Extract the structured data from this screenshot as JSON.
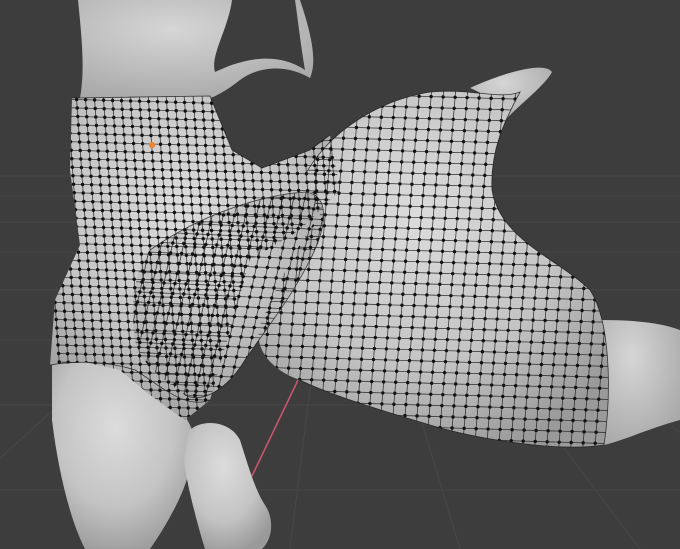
{
  "viewport": {
    "mode": "edit-mode",
    "background_color": "#3d3d3d",
    "grid_color": "#474747",
    "mesh_surface_color": "#c9c9c9",
    "wire_color": "#1e1e1e",
    "vertex_color": "#111111",
    "active_vertex_color": "#e8883a",
    "x_axis_color": "#c8566a"
  }
}
